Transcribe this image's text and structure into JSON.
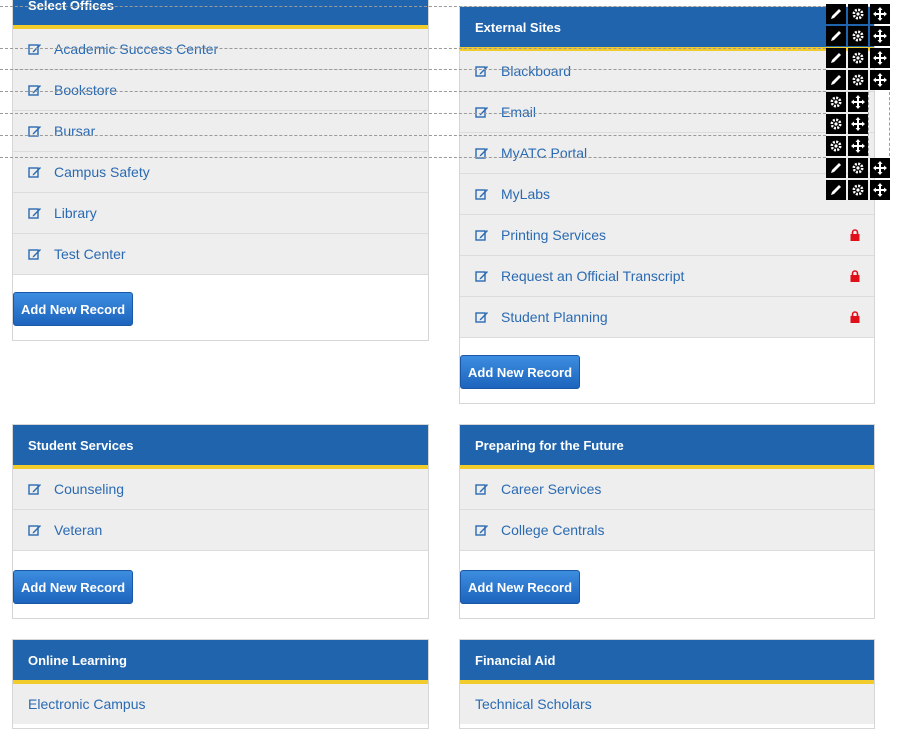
{
  "add_label": "Add New Record",
  "panels": {
    "select_offices": {
      "title": "Select Offices",
      "items": [
        "Academic Success Center",
        "Bookstore",
        "Bursar",
        "Campus Safety",
        "Library",
        "Test Center"
      ]
    },
    "external_sites": {
      "title": "External Sites",
      "items": [
        "Blackboard",
        "Email",
        "MyATC Portal",
        "MyLabs",
        "Printing Services",
        "Request an Official Transcript",
        "Student Planning"
      ],
      "locked": [
        "Printing Services",
        "Request an Official Transcript",
        "Student Planning"
      ]
    },
    "student_services": {
      "title": "Student Services",
      "items": [
        "Counseling",
        "Veteran"
      ]
    },
    "preparing_future": {
      "title": "Preparing for the Future",
      "items": [
        "Career Services",
        "College Centrals"
      ]
    },
    "online_learning": {
      "title": "Online Learning",
      "items": [
        "Electronic Campus"
      ]
    },
    "financial_aid": {
      "title": "Financial Aid",
      "items": [
        "Technical Scholars"
      ]
    }
  },
  "tool_icons": [
    "edit-icon",
    "gear-icon",
    "move-icon"
  ],
  "colors": {
    "header": "#2064ad",
    "accent": "#f2cc2a",
    "link": "#2a6ab2",
    "lock": "#e0101a"
  }
}
